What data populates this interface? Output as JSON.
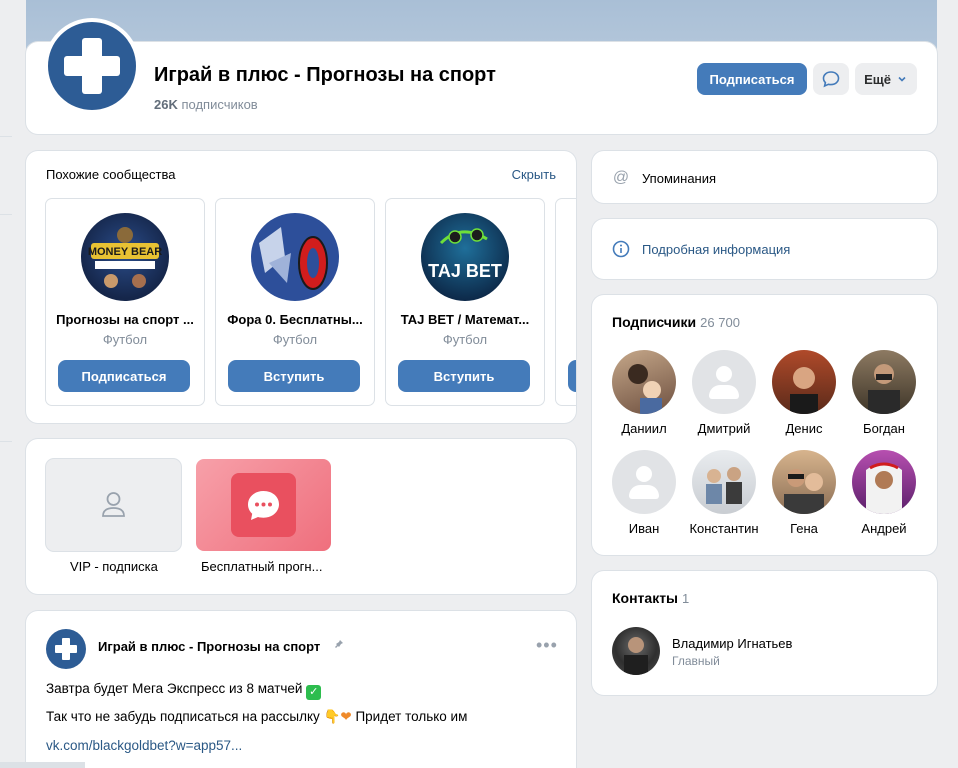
{
  "group": {
    "title": "Играй в плюс - Прогнозы на спорт",
    "subscribers_count": "26K",
    "subscribers_label": "подписчиков"
  },
  "header_actions": {
    "subscribe": "Подписаться",
    "more": "Ещё"
  },
  "similar": {
    "title": "Похожие сообщества",
    "hide": "Скрыть",
    "items": [
      {
        "name": "Прогнозы на спорт ...",
        "category": "Футбол",
        "button": "Подписаться"
      },
      {
        "name": "Фора 0. Бесплатны...",
        "category": "Футбол",
        "button": "Вступить"
      },
      {
        "name": "TAJ BET / Математ...",
        "category": "Футбол",
        "button": "Вступить"
      }
    ]
  },
  "apps": [
    {
      "label": "VIP - подписка"
    },
    {
      "label": "Бесплатный прогн..."
    }
  ],
  "post": {
    "author": "Играй в плюс - Прогнозы на спорт",
    "line1": "Завтра будет Мега Экспресс из 8 матчей",
    "line2": "Так что не забудь подписаться на рассылку",
    "line2_tail": "Придет только им",
    "link": "vk.com/blackgoldbet?w=app57..."
  },
  "right": {
    "mentions": "Упоминания",
    "details": "Подробная информация"
  },
  "subscribers_block": {
    "title": "Подписчики",
    "count": "26 700",
    "people": [
      "Даниил",
      "Дмитрий",
      "Денис",
      "Богдан",
      "Иван",
      "Константин",
      "Гена",
      "Андрей"
    ]
  },
  "contacts": {
    "title": "Контакты",
    "count": "1",
    "name": "Владимир Игнатьев",
    "role": "Главный"
  },
  "colors": {
    "accent": "#447bba",
    "link": "#2a5885",
    "muted": "#818c99"
  }
}
